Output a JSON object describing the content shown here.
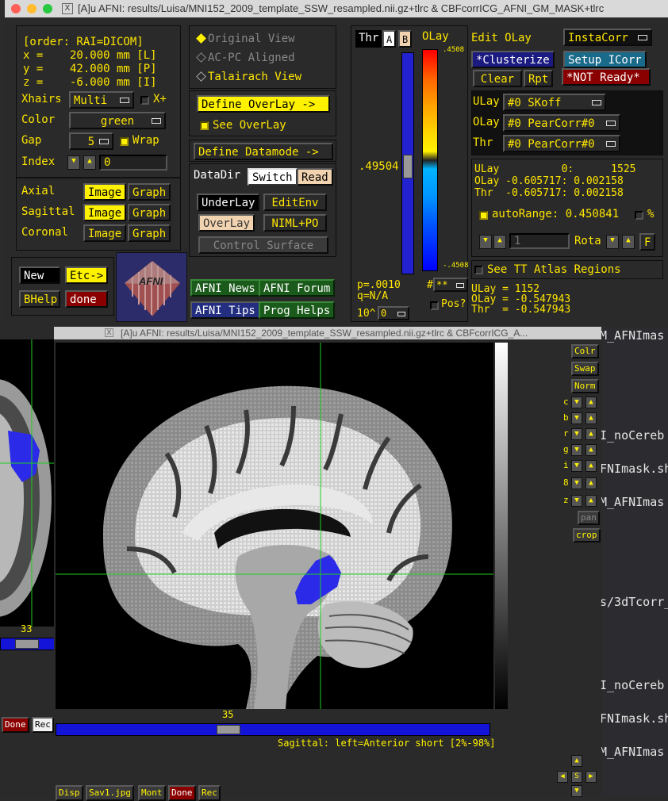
{
  "main_window": {
    "title": "[A]u AFNI: results/Luisa/MNI152_2009_template_SSW_resampled.nii.gz+tlrc & CBFcorrICG_AFNI_GM_MASK+tlrc",
    "coords": {
      "order": "[order: RAI=DICOM]",
      "x": "x =    20.000 mm [L]",
      "y": "y =    42.000 mm [P]",
      "z": "z =    -6.000 mm [I]"
    },
    "xhairs": {
      "label": "Xhairs",
      "value": "Multi",
      "xplus": "X+"
    },
    "color": {
      "label": "Color",
      "value": "green"
    },
    "gap": {
      "label": "Gap",
      "value": "5",
      "wrap": "Wrap"
    },
    "index": {
      "label": "Index",
      "value": "0"
    },
    "views": [
      {
        "name": "Axial",
        "image": "Image",
        "graph": "Graph"
      },
      {
        "name": "Sagittal",
        "image": "Image",
        "graph": "Graph"
      },
      {
        "name": "Coronal",
        "image": "Image",
        "graph": "Graph"
      }
    ],
    "buttons": {
      "new": "New",
      "etc": "Etc->",
      "bhelp": "BHelp",
      "done": "done",
      "news": "AFNI News",
      "forum": "AFNI Forum",
      "tips": "AFNI Tips",
      "prog": "Prog Helps"
    },
    "logo_text": "AFNI",
    "view_modes": [
      "Original View",
      "AC-PC Aligned",
      "Talairach View"
    ],
    "define_overlay": "Define OverLay ->",
    "see_overlay": "See OverLay",
    "define_datamode": "Define Datamode ->",
    "datadir": "DataDir",
    "switch": "Switch",
    "read": "Read",
    "underlay_btn": "UnderLay",
    "editenv": "EditEnv",
    "overlay_btn": "OverLay",
    "nimlpo": "NIML+PO",
    "control_surface": "Control Surface",
    "thr": "Thr",
    "a": "A",
    "b": "B",
    "olay_label": "OLay",
    "scale_top": ".4508",
    "scale_bottom": "-.4508",
    "thr_value": ".49504",
    "pvals": {
      "p": "p=.0010",
      "q": "q=N/A"
    },
    "stars": "**",
    "pos": "Pos?",
    "exp": "10^",
    "exp_val": "0",
    "edit_olay": "Edit OLay",
    "instacorr": "InstaCorr",
    "clusterize": "*Clusterize",
    "setup_icorr": "Setup ICorr",
    "clear": "Clear",
    "rpt": "Rpt",
    "not_ready": "*NOT Ready*",
    "sub_ulay": {
      "label": "ULay",
      "value": "#0 SKoff"
    },
    "sub_olay": {
      "label": "OLay",
      "value": "#0 PearCorr#0"
    },
    "sub_thr": {
      "label": "Thr",
      "value": "#0 PearCorr#0"
    },
    "vals": {
      "h": "ULay          0:      1525",
      "o": "OLay -0.605717: 0.002158",
      "t": "Thr  -0.605717: 0.002158"
    },
    "autorange": "autoRange: 0.450841",
    "pct": "%",
    "rota_val": "1",
    "rota": "Rota",
    "f": "F",
    "see_tt": "See TT Atlas Regions",
    "readout": {
      "u": "ULay = 1152",
      "o": "OLay = -0.547943",
      "t": "Thr  = -0.547943"
    }
  },
  "image_window": {
    "title": "[A]u AFNI: results/Luisa/MNI152_2009_template_SSW_resampled.nii.gz+tlrc & CBFcorrICG_A...",
    "slice_number": "35",
    "left_slice_number": "33",
    "status": "Sagittal: left=Anterior short [2%-98%]",
    "side_buttons": [
      "Colr",
      "Swap",
      "Norm"
    ],
    "side_letters": [
      "c",
      "b",
      "r",
      "g",
      "i",
      "8",
      "z"
    ],
    "pan": "pan",
    "crop": "crop",
    "bottom_buttons": [
      "Disp",
      "Sav1.jpg",
      "Mont",
      "Done",
      "Rec"
    ],
    "left_bottom": [
      "Done",
      "Rec"
    ]
  },
  "terminal": {
    "lines": [
      "M_AFNImas",
      "I_noCereb",
      "FNImask.sh",
      "M_AFNImas",
      "s/3dTcorr_",
      "I_noCereb",
      "FNImask.sh",
      "M_AFNImas"
    ]
  },
  "colors": {
    "yellow": "#fff200",
    "overlay_blue": "#2a2ae8",
    "crosshair": "#1ed01e"
  }
}
